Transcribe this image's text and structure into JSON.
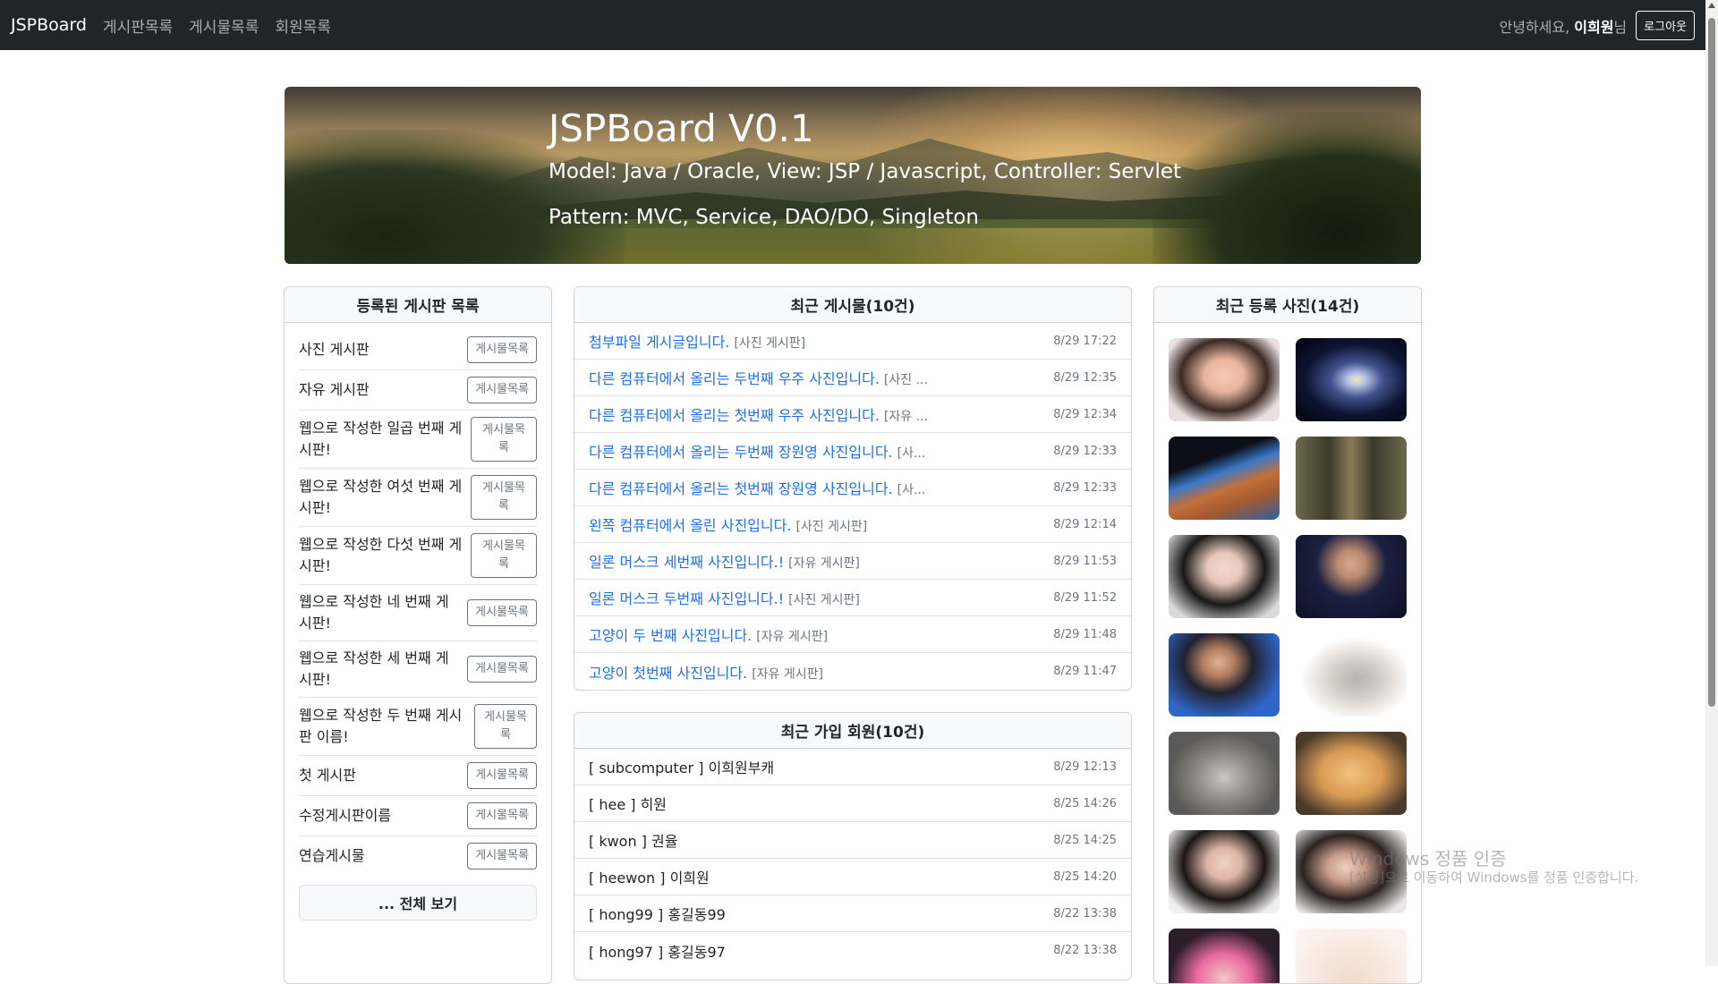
{
  "navbar": {
    "brand": "JSPBoard",
    "links": [
      "게시판목록",
      "게시물목록",
      "회원목록"
    ],
    "greeting_prefix": "안녕하세요, ",
    "user_name": "이희원",
    "greeting_suffix": "님",
    "logout_label": "로그아웃"
  },
  "hero": {
    "title": "JSPBoard V0.1",
    "line1": "Model: Java / Oracle, View: JSP / Javascript, Controller: Servlet",
    "line2": "Pattern: MVC, Service, DAO/DO, Singleton"
  },
  "boards_card": {
    "header": "등록된 게시판 목록",
    "items": [
      {
        "name": "사진 게시판",
        "button": "게시물목록"
      },
      {
        "name": "자유 게시판",
        "button": "게시물목록"
      },
      {
        "name": "웹으로 작성한 일곱 번째 게시판!",
        "button": "게시물목록"
      },
      {
        "name": "웹으로 작성한 여섯 번째 게시판!",
        "button": "게시물목록"
      },
      {
        "name": "웹으로 작성한 다섯 번째 게시판!",
        "button": "게시물목록"
      },
      {
        "name": "웹으로 작성한 네 번째 게시판!",
        "button": "게시물목록"
      },
      {
        "name": "웹으로 작성한 세 번째 게시판!",
        "button": "게시물목록"
      },
      {
        "name": "웹으로 작성한 두 번째 게시판 이름!",
        "button": "게시물목록"
      },
      {
        "name": "첫 게시판",
        "button": "게시물목록"
      },
      {
        "name": "수정게시판이름",
        "button": "게시물목록"
      },
      {
        "name": "연습게시물",
        "button": "게시물목록"
      }
    ],
    "view_all": "... 전체 보기"
  },
  "posts_card": {
    "header": "최근 게시물(10건)",
    "items": [
      {
        "title": "첨부파일 게시글입니다.",
        "board": "[사진 게시판]",
        "date": "8/29 17:22"
      },
      {
        "title": "다른 컴퓨터에서 올리는 두번째 우주 사진입니다.",
        "board": "[사진 ...",
        "date": "8/29 12:35"
      },
      {
        "title": "다른 컴퓨터에서 올리는 첫번째 우주 사진입니다.",
        "board": "[자유 ...",
        "date": "8/29 12:34"
      },
      {
        "title": "다른 컴퓨터에서 올리는 두번째 장원영 사진입니다.",
        "board": "[사...",
        "date": "8/29 12:33"
      },
      {
        "title": "다른 컴퓨터에서 올리는 첫번째 장원영 사진입니다.",
        "board": "[사...",
        "date": "8/29 12:33"
      },
      {
        "title": "왼쪽 컴퓨터에서 올린 사진입니다.",
        "board": "[사진 게시판]",
        "date": "8/29 12:14"
      },
      {
        "title": "일론 머스크 세번째 사진입니다.!",
        "board": "[자유 게시판]",
        "date": "8/29 11:53"
      },
      {
        "title": "일론 머스크 두번째 사진입니다.!",
        "board": "[사진 게시판]",
        "date": "8/29 11:52"
      },
      {
        "title": "고양이 두 번째 사진입니다.",
        "board": "[자유 게시판]",
        "date": "8/29 11:48"
      },
      {
        "title": "고양이 첫번째 사진입니다.",
        "board": "[자유 게시판]",
        "date": "8/29 11:47"
      }
    ]
  },
  "members_card": {
    "header": "최근 가입 회원(10건)",
    "items": [
      {
        "text": "[ subcomputer ] 이희원부캐",
        "date": "8/29 12:13"
      },
      {
        "text": "[ hee ] 히원",
        "date": "8/25 14:26"
      },
      {
        "text": "[ kwon ] 권율",
        "date": "8/25 14:25"
      },
      {
        "text": "[ heewon ] 이희원",
        "date": "8/25 14:20"
      },
      {
        "text": "[ hong99 ] 홍길동99",
        "date": "8/22 13:38"
      },
      {
        "text": "[ hong97 ] 홍길동97",
        "date": "8/22 13:38"
      }
    ]
  },
  "photos_card": {
    "header": "최근 등록 사진(14건)",
    "photos": [
      "portrait-photo",
      "galaxy-photo",
      "earth-photo",
      "twins-photo",
      "portrait-photo",
      "elon-musk-photo",
      "elon-musk-photo",
      "kitten-photo",
      "kitten-photo",
      "pomeranian-photo",
      "portrait-photo",
      "portrait-photo",
      "portrait-photo",
      "portrait-photo"
    ]
  },
  "watermark": {
    "line1": "Windows 정품 인증",
    "line2": "[설정]으로 이동하여 Windows를 정품 인증합니다."
  }
}
